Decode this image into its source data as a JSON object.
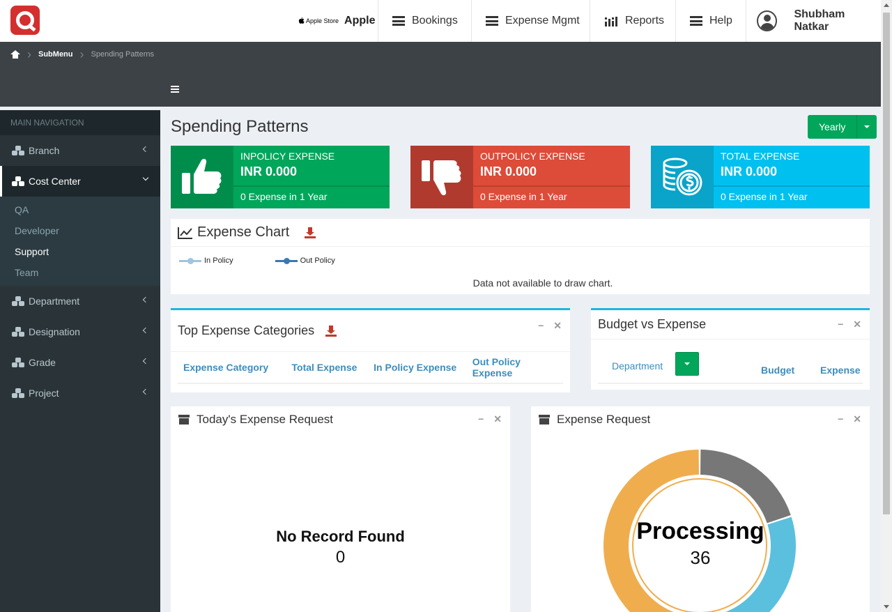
{
  "header": {
    "company_store": "Apple Store",
    "company_name": "Apple",
    "nav": [
      "Bookings",
      "Expense Mgmt",
      "Reports",
      "Help"
    ],
    "user_name": "Shubham Natkar"
  },
  "breadcrumb": {
    "submenu": "SubMenu",
    "current": "Spending Patterns"
  },
  "sidebar": {
    "heading": "MAIN NAVIGATION",
    "items": [
      {
        "label": "Branch"
      },
      {
        "label": "Cost Center"
      },
      {
        "label": "Department"
      },
      {
        "label": "Designation"
      },
      {
        "label": "Grade"
      },
      {
        "label": "Project"
      }
    ],
    "sub_items": [
      "QA",
      "Developer",
      "Support",
      "Team"
    ]
  },
  "page": {
    "title": "Spending Patterns",
    "period": "Yearly"
  },
  "stats": [
    {
      "title": "INPOLICY EXPENSE",
      "value": "INR 0.000",
      "desc": "0 Expense in 1 Year",
      "color": "#00a65a",
      "icon": "thumbs-up-icon"
    },
    {
      "title": "OUTPOLICY EXPENSE",
      "value": "INR 0.000",
      "desc": "0 Expense in 1 Year",
      "color": "#dd4b39",
      "icon": "thumbs-down-icon"
    },
    {
      "title": "TOTAL EXPENSE",
      "value": "INR 0.000",
      "desc": "0 Expense in 1 Year",
      "color": "#00c0ef",
      "icon": "coins-icon"
    }
  ],
  "expense_chart": {
    "title": "Expense Chart",
    "legend": [
      "In Policy",
      "Out Policy"
    ],
    "message": "Data not available to draw chart."
  },
  "top_categories": {
    "title": "Top Expense Categories",
    "columns": [
      "Expense Category",
      "Total Expense",
      "In Policy Expense",
      "Out Policy Expense"
    ]
  },
  "budget": {
    "title": "Budget vs Expense",
    "columns": [
      "Department",
      "Budget",
      "Expense"
    ]
  },
  "today_requests": {
    "title": "Today's Expense Request",
    "message": "No Record Found",
    "count": "0"
  },
  "expense_request": {
    "title": "Expense Request",
    "center_label": "Processing",
    "center_value": "36",
    "segments": [
      {
        "color": "#777777",
        "fraction": 0.2
      },
      {
        "color": "#5bc0de",
        "fraction": 0.3
      },
      {
        "color": "#f0ad4e",
        "fraction": 0.5
      }
    ]
  }
}
